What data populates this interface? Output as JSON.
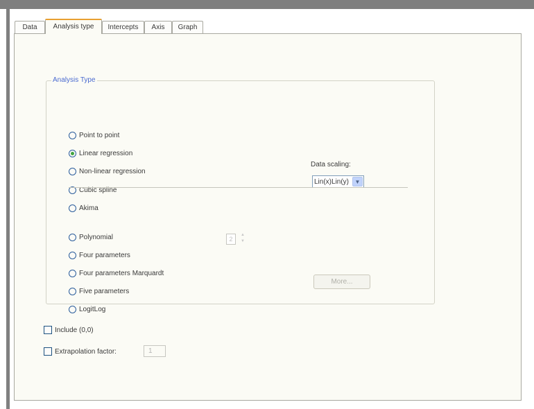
{
  "tabs": [
    {
      "label": "Data"
    },
    {
      "label": "Analysis type"
    },
    {
      "label": "Intercepts"
    },
    {
      "label": "Axis"
    },
    {
      "label": "Graph"
    }
  ],
  "active_tab": "Analysis type",
  "analysis_type": {
    "title": "Analysis Type",
    "options_top": [
      {
        "label": "Point to point",
        "selected": false
      },
      {
        "label": "Linear regression",
        "selected": true
      },
      {
        "label": "Non-linear regression",
        "selected": false
      },
      {
        "label": "Cubic spline",
        "selected": false
      },
      {
        "label": "Akima",
        "selected": false
      }
    ],
    "options_bottom": [
      {
        "label": "Polynomial",
        "selected": false
      },
      {
        "label": "Four parameters",
        "selected": false
      },
      {
        "label": "Four parameters Marquardt",
        "selected": false
      },
      {
        "label": "Five parameters",
        "selected": false
      },
      {
        "label": "LogitLog",
        "selected": false
      }
    ],
    "data_scaling_label": "Data scaling:",
    "data_scaling_value": "Lin(x)Lin(y)",
    "polynomial_degree": "2",
    "more_button_label": "More..."
  },
  "include_zero": {
    "label": "Include (0,0)",
    "checked": false
  },
  "extrapolation": {
    "label": "Extrapolation factor:",
    "checked": false,
    "value": "1"
  },
  "colors": {
    "selected_tab_accent": "#e8a030",
    "group_label": "#4a6ad0",
    "radio_selected": "#3fa43f",
    "panel_background": "#fbfbf5"
  }
}
